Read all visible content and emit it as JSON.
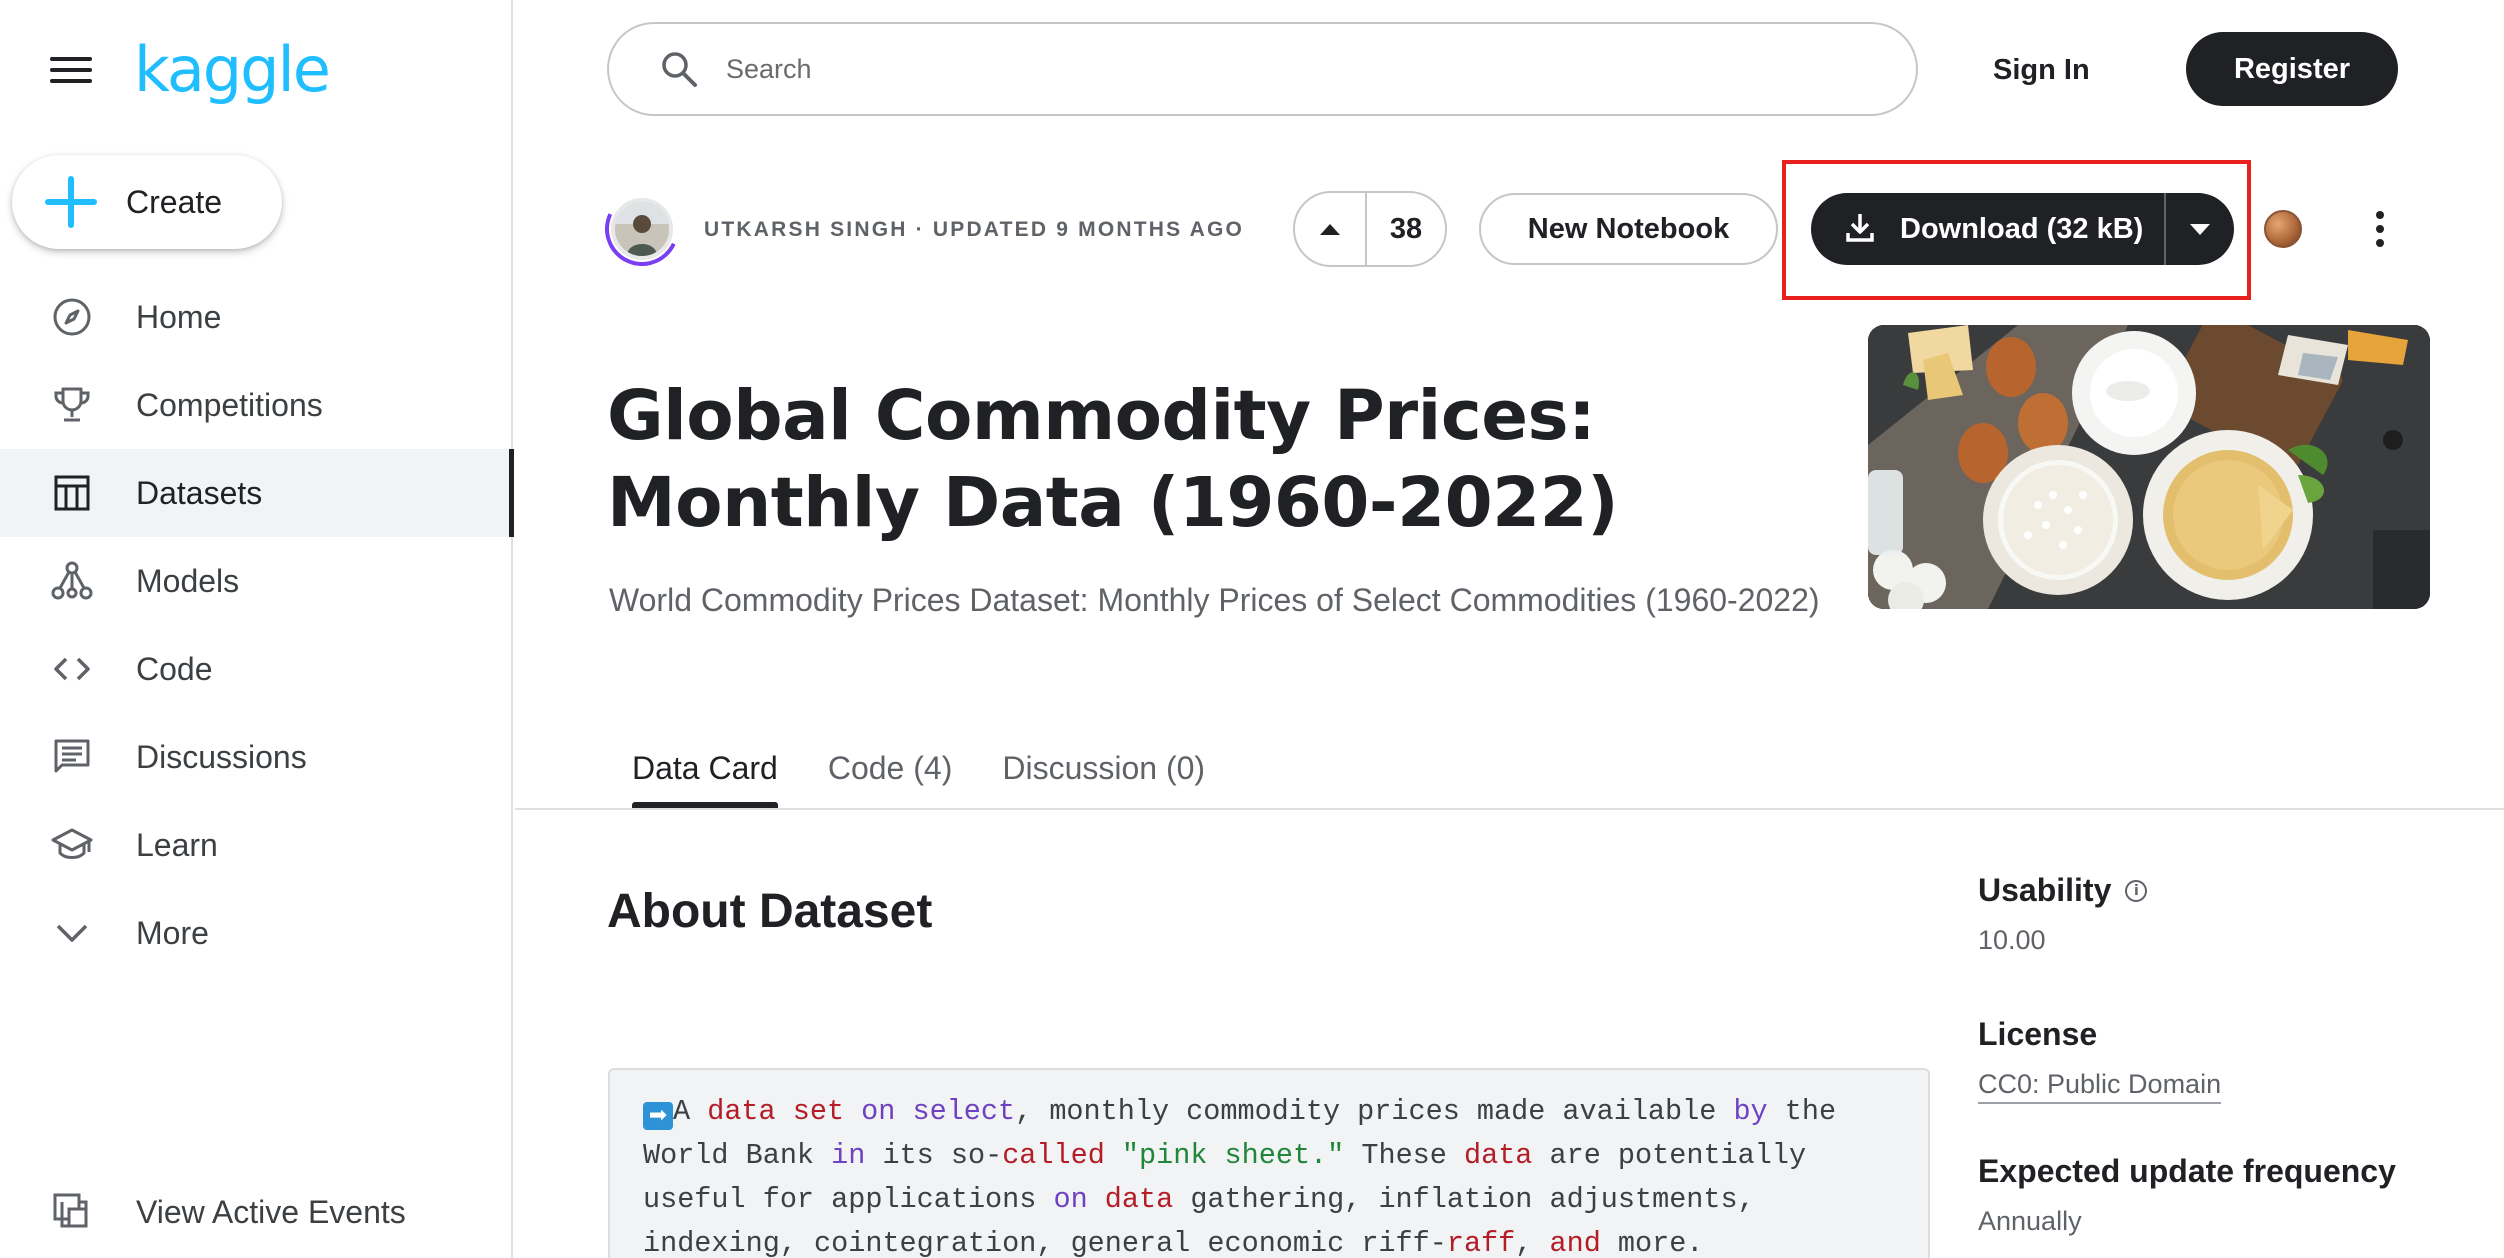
{
  "sidebar": {
    "logo": "kaggle",
    "create_label": "Create",
    "items": [
      {
        "label": "Home",
        "icon": "compass-icon"
      },
      {
        "label": "Competitions",
        "icon": "trophy-icon"
      },
      {
        "label": "Datasets",
        "icon": "table-icon",
        "active": true
      },
      {
        "label": "Models",
        "icon": "models-icon"
      },
      {
        "label": "Code",
        "icon": "code-icon"
      },
      {
        "label": "Discussions",
        "icon": "discussion-icon"
      },
      {
        "label": "Learn",
        "icon": "school-icon"
      },
      {
        "label": "More",
        "icon": "chevron-down-icon"
      }
    ],
    "view_events_label": "View Active Events"
  },
  "topbar": {
    "search_placeholder": "Search",
    "search_value": "",
    "signin_label": "Sign In",
    "register_label": "Register"
  },
  "dataset": {
    "author_meta": "UTKARSH SINGH · UPDATED 9 MONTHS AGO",
    "upvotes": "38",
    "new_notebook_label": "New Notebook",
    "download_label": "Download (32 kB)",
    "title": "Global Commodity Prices: Monthly Data (1960-2022)",
    "subtitle": "World Commodity Prices Dataset: Monthly Prices of Select Commodities (1960-2022)"
  },
  "tabs": [
    {
      "label": "Data Card",
      "active": true
    },
    {
      "label": "Code (4)"
    },
    {
      "label": "Discussion (0)"
    }
  ],
  "about": {
    "heading": "About Dataset",
    "arrow_glyph": "➡",
    "text_line1_tokens": [
      {
        "t": "A ",
        "c": ""
      },
      {
        "t": "data",
        "c": "kw-red"
      },
      {
        "t": " ",
        "c": ""
      },
      {
        "t": "set",
        "c": "kw-red"
      },
      {
        "t": " ",
        "c": ""
      },
      {
        "t": "on",
        "c": "kw-purple"
      },
      {
        "t": " ",
        "c": ""
      },
      {
        "t": "select",
        "c": "kw-purple"
      },
      {
        "t": ", monthly commodity prices made available ",
        "c": ""
      },
      {
        "t": "by",
        "c": "kw-purple"
      },
      {
        "t": " the",
        "c": ""
      }
    ],
    "text_line2_tokens": [
      {
        "t": "World Bank ",
        "c": ""
      },
      {
        "t": "in",
        "c": "kw-purple"
      },
      {
        "t": " its so-",
        "c": ""
      },
      {
        "t": "called",
        "c": "kw-red"
      },
      {
        "t": " ",
        "c": ""
      },
      {
        "t": "\"pink sheet.\"",
        "c": "kw-green"
      },
      {
        "t": " These ",
        "c": ""
      },
      {
        "t": "data",
        "c": "kw-red"
      },
      {
        "t": " are potentially",
        "c": ""
      }
    ],
    "text_line3_tokens": [
      {
        "t": "useful for applications ",
        "c": ""
      },
      {
        "t": "on",
        "c": "kw-purple"
      },
      {
        "t": " ",
        "c": ""
      },
      {
        "t": "data",
        "c": "kw-red"
      },
      {
        "t": " gathering, inflation adjustments,",
        "c": ""
      }
    ],
    "text_line4_tokens": [
      {
        "t": "indexing, cointegration, general economic riff-",
        "c": ""
      },
      {
        "t": "raff",
        "c": "kw-red"
      },
      {
        "t": ", ",
        "c": ""
      },
      {
        "t": "and",
        "c": "kw-red"
      },
      {
        "t": " more.",
        "c": ""
      }
    ]
  },
  "meta": {
    "usability_label": "Usability",
    "usability_value": "10.00",
    "license_label": "License",
    "license_value": "CC0: Public Domain",
    "frequency_label": "Expected update frequency",
    "frequency_value": "Annually"
  },
  "colors": {
    "brand": "#20beff",
    "dark": "#202124",
    "highlight": "#e8211d"
  }
}
